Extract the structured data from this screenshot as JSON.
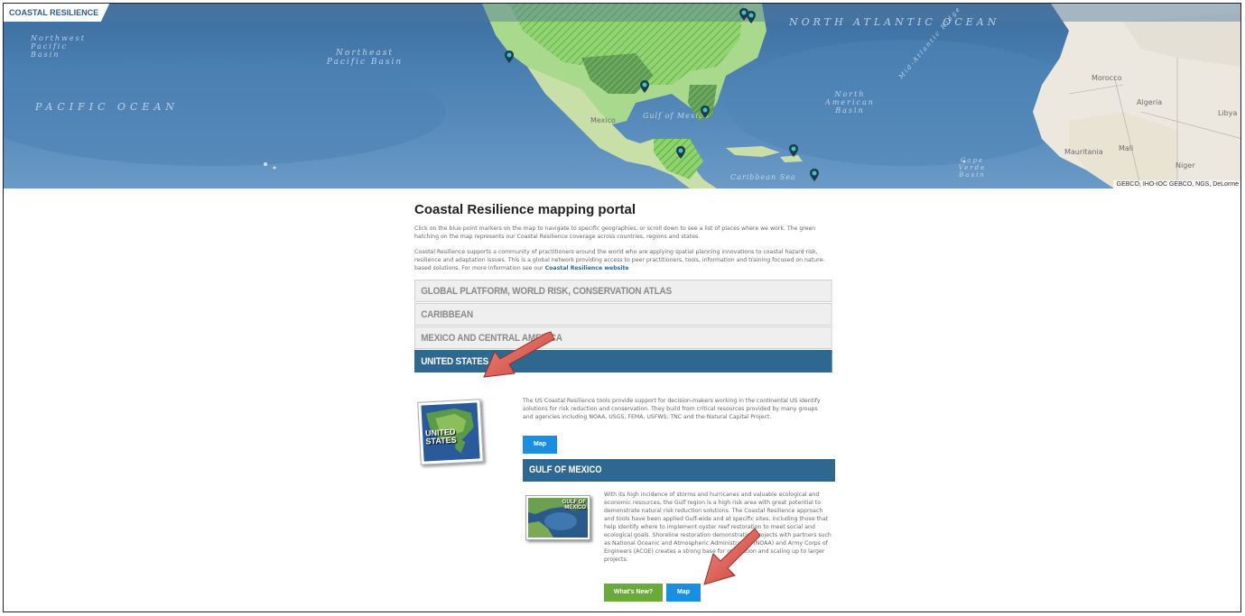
{
  "app": {
    "tab_label": "COASTAL RESILIENCE"
  },
  "map": {
    "ocean_labels": {
      "north_atlantic": "NORTH ATLANTIC OCEAN",
      "pacific": "PACIFIC OCEAN",
      "nw_pacific": "Northwest Pacific Basin",
      "ne_pacific": "Northeast Pacific Basin",
      "gulf": "Gulf of Mexico",
      "caribbean": "Caribbean Sea",
      "na_basin": "North American Basin",
      "cape_verde": "Cape Verde Basin",
      "mid_atlantic": "Mid-Atlantic Ridge"
    },
    "land_labels": {
      "mexico": "Mexico",
      "morocco": "Morocco",
      "algeria": "Algeria",
      "libya": "Libya",
      "mauritania": "Mauritania",
      "mali": "Mali",
      "niger": "Niger"
    },
    "attribution": "GEBCO, IHO-IOC GEBCO, NGS, DeLorme"
  },
  "portal": {
    "title": "Coastal Resilience mapping portal",
    "intro_1": "Click on the blue point markers on the map to navigate to specific geographies, or scroll down to see a list of places where we work. The green hatching on the map represents our Coastal Resilience coverage across countries, regions and states.",
    "intro_2": "Coastal Resilience supports a community of practitioners around the world who are applying spatial planning innovations to coastal hazard risk, resilience and adaptation issues. This is a global network providing access to peer practitioners, tools, information and training focused on nature-based solutions. For more information see our",
    "intro_link": "Coastal Resilience website"
  },
  "accordion": [
    {
      "label": "GLOBAL PLATFORM, WORLD RISK, CONSERVATION ATLAS"
    },
    {
      "label": "CARIBBEAN"
    },
    {
      "label": "MEXICO AND CENTRAL AMERICA"
    },
    {
      "label": "UNITED STATES"
    }
  ],
  "us_section": {
    "thumb_label": "UNITED STATES",
    "description": "The US Coastal Resilience tools provide support for decision-makers working in the continental US identify solutions for risk reduction and conservation. They build from critical resources provided by many groups and agencies including NOAA, USGS, FEMA, USFWS, TNC and the Natural Capital Project.",
    "map_button": "Map"
  },
  "gulf_section": {
    "header": "GULF OF MEXICO",
    "thumb_label": "GULF OF MEXICO",
    "description": "With its high incidence of storms and hurricanes and valuable ecological and economic resources, the Gulf region is a high risk area with great potential to demonstrate natural risk reduction solutions. The Coastal Resilience approach and tools have been applied Gulf-wide and at specific sites, including those that help identify where to implement oyster reef restoration to meet social and ecological goals. Shoreline restoration demonstration projects with partners such as National Oceanic and Atmospheric Administration (NOAA) and Army Corps of Engineers (ACOE) creates a strong base for replication and scaling up to larger projects.",
    "whats_new_button": "What's New?",
    "map_button": "Map"
  },
  "colors": {
    "accent_blue": "#2e6890",
    "button_blue": "#1a8ee0",
    "button_green": "#6aaa3a",
    "arrow_red": "#d9534f"
  }
}
